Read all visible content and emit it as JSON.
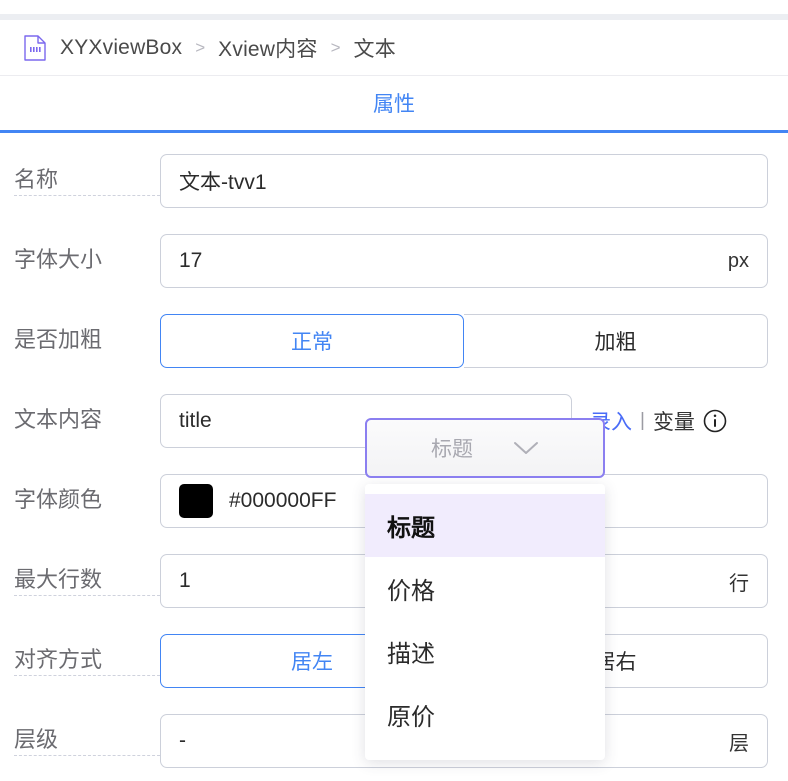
{
  "breadcrumb": {
    "icon": "document-icon",
    "items": [
      "XYXviewBox",
      "Xview内容",
      "文本"
    ],
    "separator": ">"
  },
  "tabs": [
    {
      "label": "属性",
      "active": true
    }
  ],
  "form": {
    "rows": {
      "name": {
        "label": "名称",
        "value": "文本-tvv1"
      },
      "font_size": {
        "label": "字体大小",
        "value": "17",
        "unit": "px"
      },
      "bold": {
        "label": "是否加粗",
        "options": [
          "正常",
          "加粗"
        ],
        "selected": "正常"
      },
      "text_content": {
        "label": "文本内容",
        "value": "title",
        "mode_input": "录入",
        "mode_sep": "|",
        "mode_variable": "变量",
        "info_icon": "info-circle-icon"
      },
      "font_color": {
        "label": "字体颜色",
        "value": "#000000FF",
        "swatch": "#000000"
      },
      "max_lines": {
        "label": "最大行数",
        "value": "1",
        "unit": "行"
      },
      "align": {
        "label": "对齐方式",
        "options": [
          "居左",
          "居右"
        ],
        "selected": "居左"
      },
      "layer": {
        "label": "层级",
        "value": "-",
        "unit": "层"
      }
    }
  },
  "dropdown": {
    "placeholder": "标题",
    "chevron_icon": "chevron-down-icon",
    "open": true,
    "options": [
      "标题",
      "价格",
      "描述",
      "原价"
    ],
    "highlighted": "标题"
  },
  "colors": {
    "accent_blue": "#4285f4",
    "link_blue": "#4a6cf7",
    "focus_purple": "#8b7ff0",
    "highlight_lavender": "#f1ecfd",
    "border_gray": "#ccd0da",
    "label_gray": "#6b6b70"
  }
}
